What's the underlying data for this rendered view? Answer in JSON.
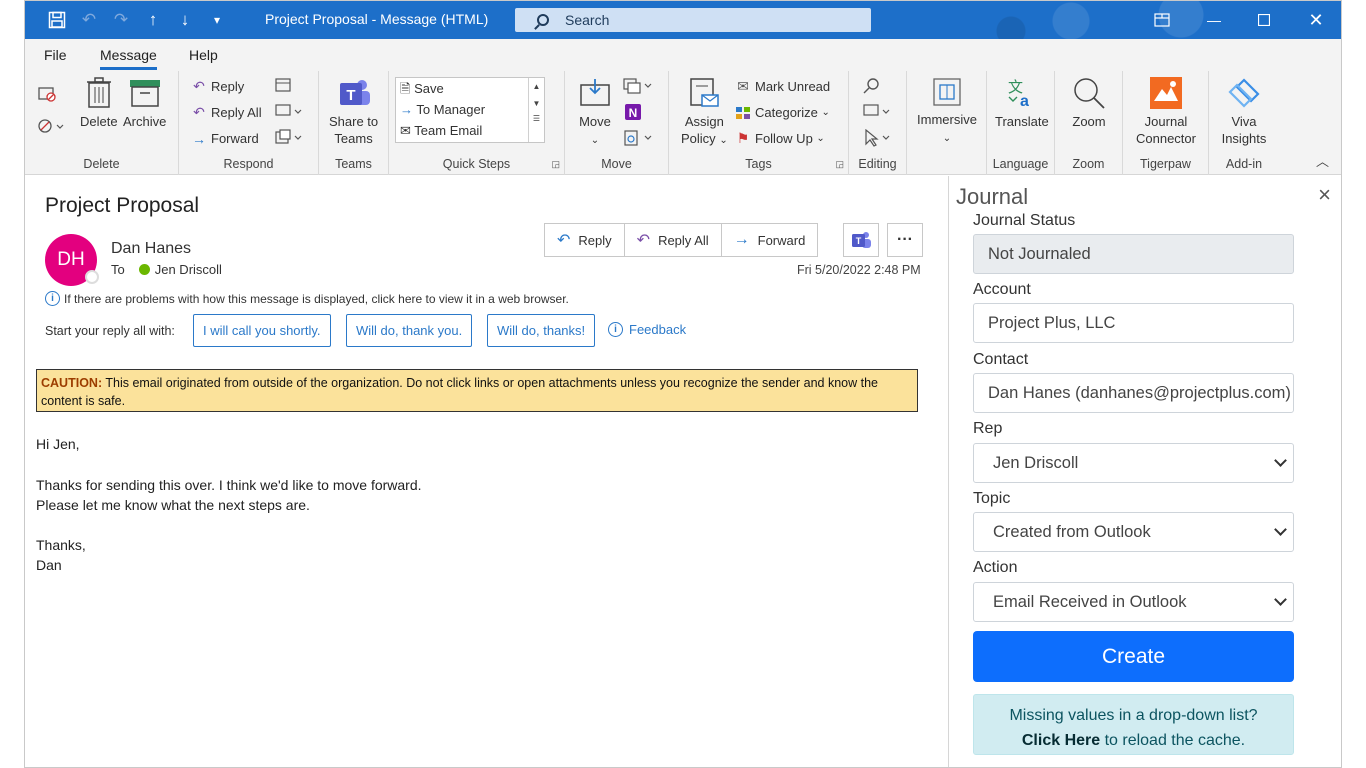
{
  "window": {
    "title": "Project Proposal  -  Message (HTML)",
    "search_placeholder": "Search"
  },
  "tabs": [
    "File",
    "Message",
    "Help"
  ],
  "ribbon": {
    "delete_group": {
      "label": "Delete",
      "delete": "Delete",
      "archive": "Archive"
    },
    "respond_group": {
      "label": "Respond",
      "reply": "Reply",
      "reply_all": "Reply All",
      "forward": "Forward"
    },
    "teams_group": {
      "label": "Teams",
      "share_line1": "Share to",
      "share_line2": "Teams"
    },
    "quick_steps": {
      "label": "Quick Steps",
      "items": [
        "Save",
        "To Manager",
        "Team Email"
      ]
    },
    "move_group": {
      "label": "Move",
      "move": "Move"
    },
    "tags_group": {
      "label": "Tags",
      "assign_line1": "Assign",
      "assign_line2": "Policy",
      "mark_unread": "Mark Unread",
      "categorize": "Categorize",
      "follow_up": "Follow Up"
    },
    "editing_group": {
      "label": "Editing"
    },
    "immersive": {
      "label": "Immersive"
    },
    "language_group": {
      "label": "Language",
      "translate": "Translate"
    },
    "zoom_group": {
      "label": "Zoom",
      "zoom": "Zoom"
    },
    "tigerpaw_group": {
      "label": "Tigerpaw",
      "line1": "Journal",
      "line2": "Connector"
    },
    "addin_group": {
      "label": "Add-in",
      "line1": "Viva",
      "line2": "Insights"
    }
  },
  "message": {
    "subject": "Project Proposal",
    "avatar_initials": "DH",
    "sender": "Dan Hanes",
    "to_label": "To",
    "recipient": "Jen Driscoll",
    "actions": {
      "reply": "Reply",
      "reply_all": "Reply All",
      "forward": "Forward"
    },
    "date": "Fri 5/20/2022 2:48 PM",
    "info_text": "If there are problems with how this message is displayed, click here to view it in a web browser.",
    "suggest_label": "Start your reply all with:",
    "suggestions": [
      "I will call you shortly.",
      "Will do, thank you.",
      "Will do, thanks!"
    ],
    "feedback": "Feedback",
    "caution_label": "CAUTION:",
    "caution_text": "This email originated from outside of the organization. Do not click links or open attachments unless you recognize the sender and know the content is safe.",
    "body": {
      "greeting": "Hi Jen,",
      "line1": "Thanks for sending this over. I think we'd like to move forward.",
      "line2": "Please let me know what the next steps are.",
      "closing": "Thanks,",
      "signature": "Dan"
    }
  },
  "journal": {
    "title": "Journal",
    "status_label": "Journal Status",
    "status_value": "Not Journaled",
    "account_label": "Account",
    "account_value": "Project Plus, LLC",
    "contact_label": "Contact",
    "contact_value": "Dan Hanes (danhanes@projectplus.com)",
    "rep_label": "Rep",
    "rep_value": "Jen Driscoll",
    "topic_label": "Topic",
    "topic_value": "Created from Outlook",
    "action_label": "Action",
    "action_value": "Email Received in Outlook",
    "create_button": "Create",
    "alert_line1": "Missing values in a drop-down list?",
    "alert_bold": "Click Here",
    "alert_rest": " to reload the cache."
  },
  "colors": {
    "titlebar": "#1d6fc9",
    "avatar": "#e3007f",
    "caution_bg": "#fbe29b",
    "create_button": "#0d6efd",
    "alert_bg": "#d1ecf1"
  }
}
